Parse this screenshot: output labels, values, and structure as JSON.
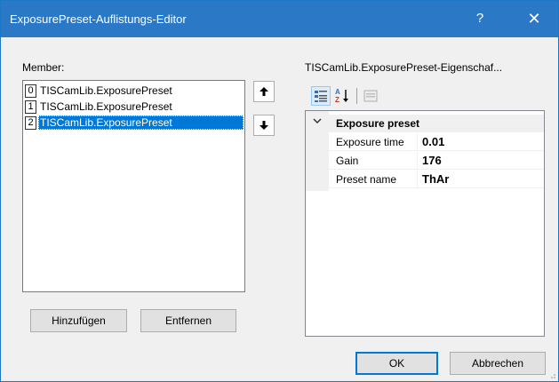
{
  "window": {
    "title": "ExposurePreset-Auflistungs-Editor",
    "help_label": "?",
    "close_label": "✕"
  },
  "members": {
    "label": "Member:",
    "items": [
      {
        "index": "0",
        "label": "TISCamLib.ExposurePreset"
      },
      {
        "index": "1",
        "label": "TISCamLib.ExposurePreset"
      },
      {
        "index": "2",
        "label": "TISCamLib.ExposurePreset"
      }
    ],
    "selected_index": 2
  },
  "move": {
    "up_icon": "arrow-up-icon",
    "down_icon": "arrow-down-icon"
  },
  "properties": {
    "label": "TISCamLib.ExposurePreset-Eigenschaf...",
    "toolbar": {
      "categorized_icon": "categorized-icon",
      "alphabetical_icon": "sort-alphabetical-icon",
      "property_pages_icon": "property-pages-icon"
    },
    "category": "Exposure preset",
    "rows": [
      {
        "name": "Exposure time",
        "value": "0.01"
      },
      {
        "name": "Gain",
        "value": "176"
      },
      {
        "name": "Preset name",
        "value": "ThAr"
      }
    ]
  },
  "buttons": {
    "add": "Hinzufügen",
    "remove": "Entfernen",
    "ok": "OK",
    "cancel": "Abbrechen"
  },
  "colors": {
    "titlebar": "#2b78c7",
    "selection": "#0078d7",
    "dialog_bg": "#f0f0f0"
  }
}
